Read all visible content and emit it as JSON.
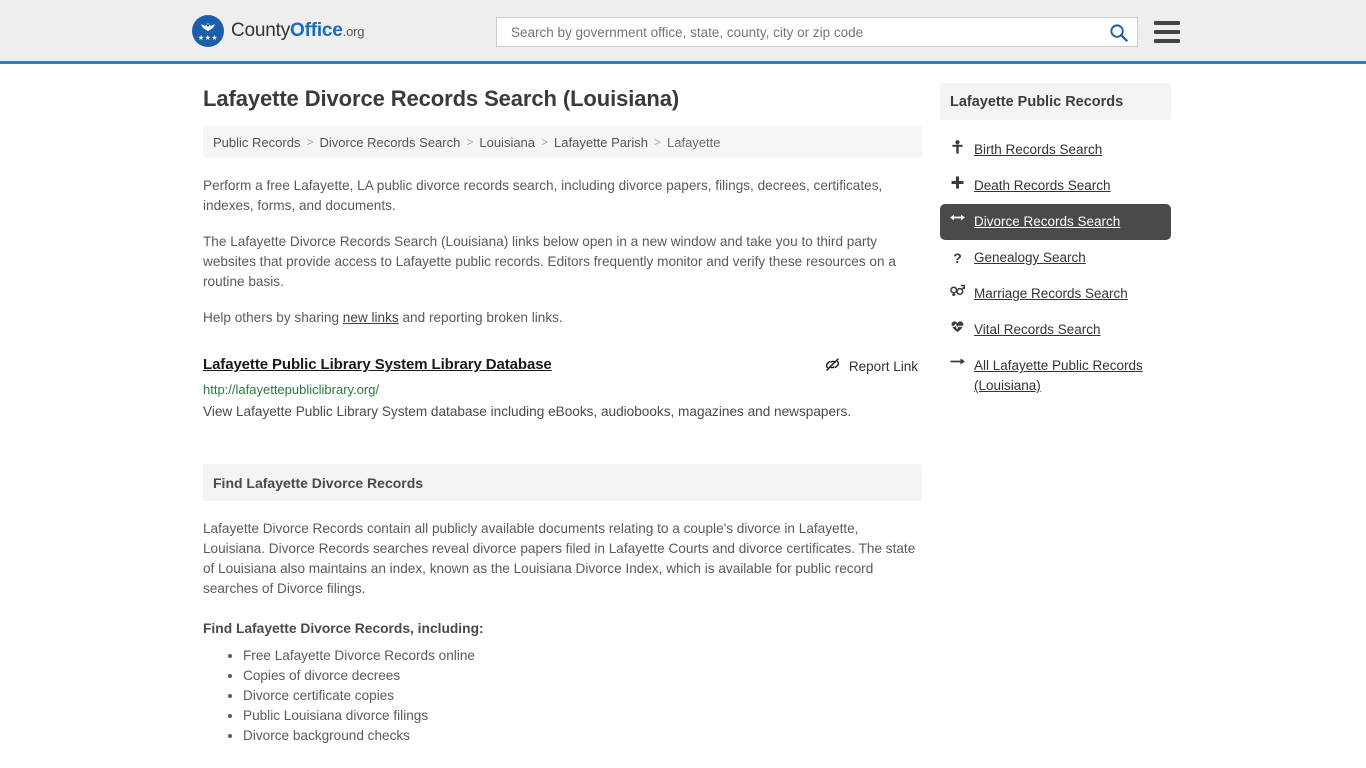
{
  "header": {
    "logo": {
      "county": "County",
      "office": "Office",
      "dotorg": ".org",
      "stars": "★★★",
      "icon": "eagle-emblem-icon"
    },
    "search": {
      "placeholder": "Search by government office, state, county, city or zip code",
      "value": "",
      "search_icon": "search-icon"
    },
    "menu_icon": "hamburger-menu-icon"
  },
  "page": {
    "title": "Lafayette Divorce Records Search (Louisiana)"
  },
  "breadcrumb": {
    "separator": ">",
    "items": [
      {
        "label": "Public Records",
        "current": false
      },
      {
        "label": "Divorce Records Search",
        "current": false
      },
      {
        "label": "Louisiana",
        "current": false
      },
      {
        "label": "Lafayette Parish",
        "current": false
      },
      {
        "label": "Lafayette",
        "current": true
      }
    ]
  },
  "intro": {
    "p1": "Perform a free Lafayette, LA public divorce records search, including divorce papers, filings, decrees, certificates, indexes, forms, and documents.",
    "p2": "The Lafayette Divorce Records Search (Louisiana) links below open in a new window and take you to third party websites that provide access to Lafayette public records. Editors frequently monitor and verify these resources on a routine basis.",
    "p3_before": "Help others by sharing ",
    "p3_link": "new links",
    "p3_after": " and reporting broken links."
  },
  "result": {
    "title": "Lafayette Public Library System Library Database",
    "report_label": "Report Link",
    "report_icon": "broken-link-icon",
    "url": "http://lafayettepubliclibrary.org/",
    "description": "View Lafayette Public Library System database including eBooks, audiobooks, magazines and newspapers."
  },
  "section": {
    "heading": "Find Lafayette Divorce Records",
    "paragraph": "Lafayette Divorce Records contain all publicly available documents relating to a couple's divorce in Lafayette, Louisiana. Divorce Records searches reveal divorce papers filed in Lafayette Courts and divorce certificates. The state of Louisiana also maintains an index, known as the Louisiana Divorce Index, which is available for public record searches of Divorce filings.",
    "list_heading": "Find Lafayette Divorce Records, including:",
    "list_items": [
      "Free Lafayette Divorce Records online",
      "Copies of divorce decrees",
      "Divorce certificate copies",
      "Public Louisiana divorce filings",
      "Divorce background checks"
    ]
  },
  "sidebar": {
    "heading": "Lafayette Public Records",
    "items": [
      {
        "label": "Birth Records Search",
        "icon": "baby-icon",
        "icon_glyph": "࢈",
        "active": false
      },
      {
        "label": "Death Records Search",
        "icon": "cross-plus-icon",
        "icon_glyph": "✚",
        "active": false
      },
      {
        "label": "Divorce Records Search",
        "icon": "left-right-arrow-icon",
        "icon_glyph": "↔",
        "active": true
      },
      {
        "label": "Genealogy Search",
        "icon": "question-mark-icon",
        "icon_glyph": "?",
        "active": false
      },
      {
        "label": "Marriage Records Search",
        "icon": "venus-mars-icon",
        "icon_glyph": "⚥",
        "active": false
      },
      {
        "label": "Vital Records Search",
        "icon": "heartbeat-icon",
        "icon_glyph": "♥",
        "active": false
      },
      {
        "label": "All Lafayette Public Records (Louisiana)",
        "icon": "arrow-right-icon",
        "icon_glyph": "→",
        "active": false
      }
    ]
  },
  "colors": {
    "brand_blue": "#1b6bbd",
    "header_border": "#3b7cb5",
    "active_bg": "#4a4a4a",
    "url_green": "#2a7a3c",
    "panel_gray": "#f4f4f4"
  }
}
